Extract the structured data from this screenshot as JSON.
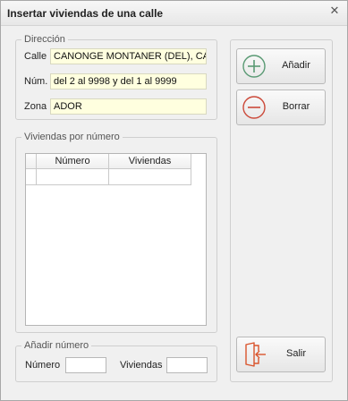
{
  "window": {
    "title": "Insertar viviendas de una calle",
    "close_glyph": "✕"
  },
  "direccion": {
    "legend": "Dirección",
    "calle_label": "Calle",
    "calle_value": "CANONGE MONTANER (DEL), CAN",
    "num_label": "Núm.",
    "num_value": "del 2 al 9998 y del 1 al 9999",
    "zona_label": "Zona",
    "zona_value": "ADOR"
  },
  "viviendas_por_numero": {
    "legend": "Viviendas por número",
    "columns": [
      "Número",
      "Viviendas"
    ],
    "rows": [
      [
        "",
        ""
      ]
    ]
  },
  "anadir_numero": {
    "legend": "Añadir número",
    "numero_label": "Número",
    "numero_value": "",
    "viviendas_label": "Viviendas",
    "viviendas_value": ""
  },
  "buttons": {
    "anadir": {
      "label": "Añadir",
      "icon": "plus-circle-icon"
    },
    "borrar": {
      "label": "Borrar",
      "icon": "minus-circle-icon"
    },
    "salir": {
      "label": "Salir",
      "icon": "exit-door-icon"
    }
  },
  "colors": {
    "field_bg": "#ffffdf",
    "add_icon": "#5a9a74",
    "remove_icon": "#cc4a3a",
    "exit_icon": "#d9542c"
  }
}
